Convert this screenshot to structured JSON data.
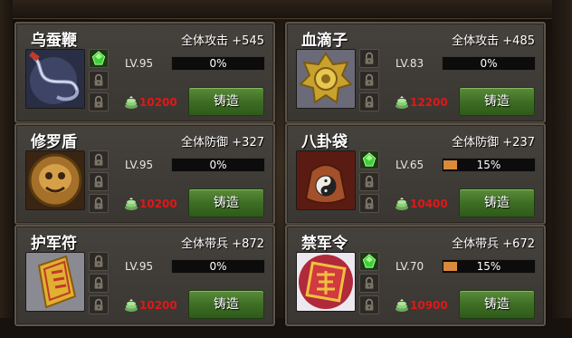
{
  "forge_label": "铸造",
  "progress_color": "#d98a3c",
  "cost_color": "#e01818",
  "items": [
    {
      "name": "乌蚕鞭",
      "stat": "全体攻击 +545",
      "level": "LV.95",
      "progress": "0%",
      "progress_value": 0,
      "cost": "10200",
      "slots": [
        "gem-green",
        "lock",
        "lock"
      ]
    },
    {
      "name": "血滴子",
      "stat": "全体攻击 +485",
      "level": "LV.83",
      "progress": "0%",
      "progress_value": 0,
      "cost": "12200",
      "slots": [
        "lock",
        "lock",
        "lock"
      ]
    },
    {
      "name": "修罗盾",
      "stat": "全体防御 +327",
      "level": "LV.95",
      "progress": "0%",
      "progress_value": 0,
      "cost": "10200",
      "slots": [
        "lock",
        "lock",
        "lock"
      ]
    },
    {
      "name": "八卦袋",
      "stat": "全体防御 +237",
      "level": "LV.65",
      "progress": "15%",
      "progress_value": 15,
      "cost": "10400",
      "slots": [
        "gem-green",
        "lock",
        "lock"
      ]
    },
    {
      "name": "护军符",
      "stat": "全体带兵 +872",
      "level": "LV.95",
      "progress": "0%",
      "progress_value": 0,
      "cost": "10200",
      "slots": [
        "lock",
        "lock",
        "lock"
      ]
    },
    {
      "name": "禁军令",
      "stat": "全体带兵 +672",
      "level": "LV.70",
      "progress": "15%",
      "progress_value": 15,
      "cost": "10900",
      "slots": [
        "gem-green",
        "lock",
        "lock"
      ]
    }
  ]
}
